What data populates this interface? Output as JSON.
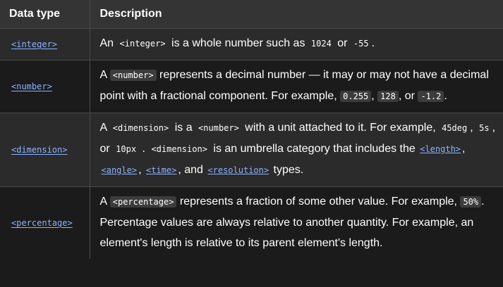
{
  "headers": {
    "type": "Data type",
    "description": "Description"
  },
  "rows": [
    {
      "type": "<integer>",
      "parts": [
        "An",
        "<integer>",
        "is a whole number such as",
        "1024",
        "or",
        "-55",
        "."
      ]
    },
    {
      "type": "<number>",
      "parts": [
        "A",
        "<number>",
        "represents a decimal number — it may or may not have a decimal point with a fractional component. For example,",
        "0.255",
        ",",
        "128",
        ",",
        "or",
        "-1.2",
        "."
      ]
    },
    {
      "type": "<dimension>",
      "parts": [
        "A",
        "<dimension>",
        "is a",
        "<number>",
        "with a unit attached to it. For example,",
        "45deg",
        ",",
        "5s",
        ", or",
        "10px",
        ".",
        "<dimension>",
        "is an umbrella category that includes the",
        "<length>",
        ",",
        "<angle>",
        ",",
        "<time>",
        ", and",
        "<resolution>",
        "types."
      ]
    },
    {
      "type": "<percentage>",
      "parts": [
        "A",
        "<percentage>",
        "represents a fraction of some other value. For example,",
        "50%",
        ". Percentage values are always relative to another quantity. For example, an element's length is relative to its parent element's length."
      ]
    }
  ]
}
